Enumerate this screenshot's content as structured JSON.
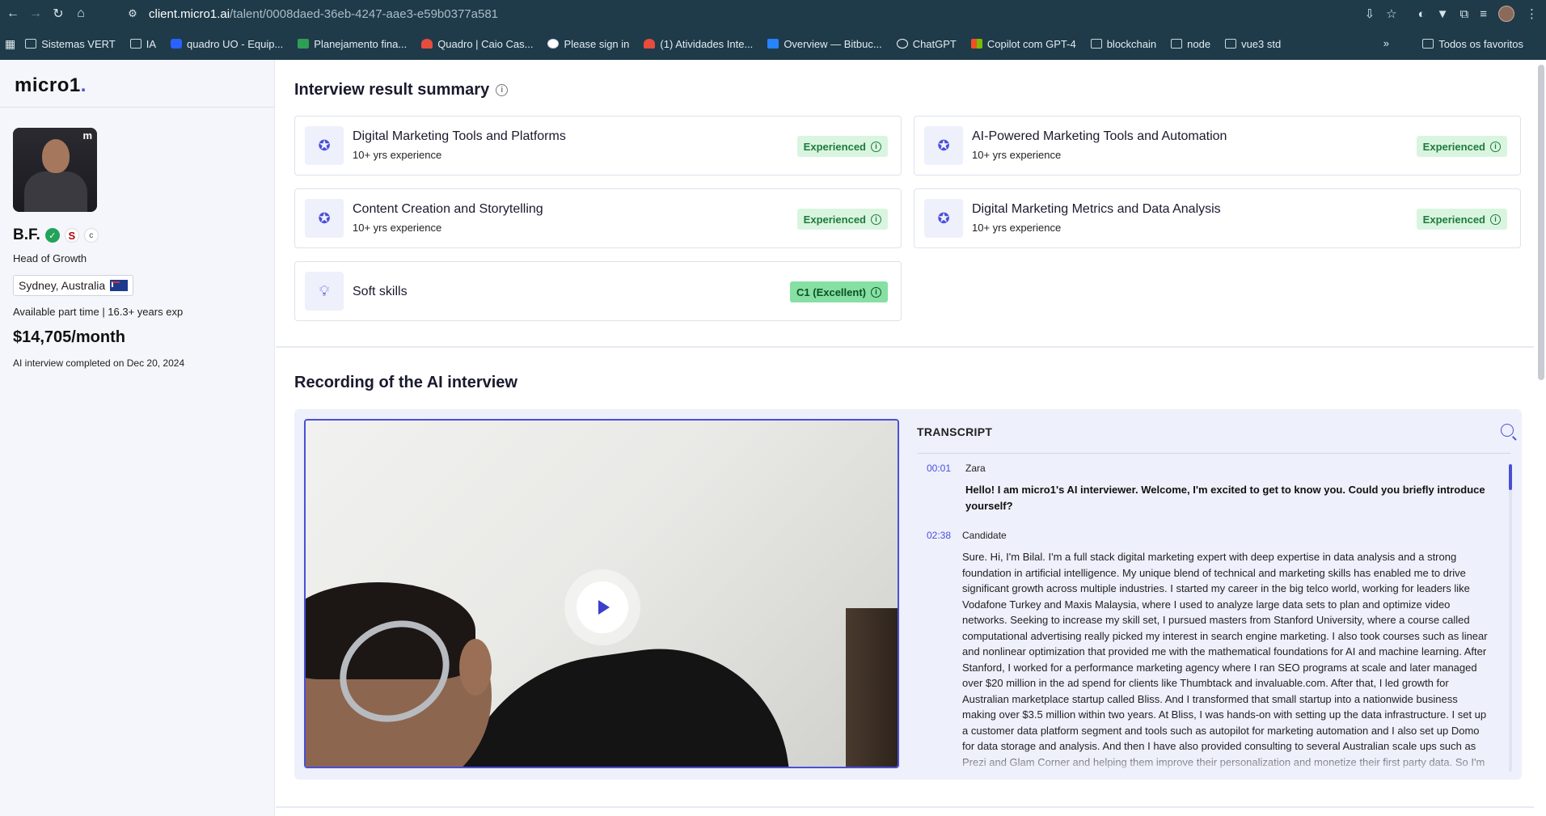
{
  "browser": {
    "url_host": "client.micro1.ai",
    "url_path": "/talent/0008daed-36eb-4247-aae3-e59b0377a581",
    "bookmarks": [
      {
        "label": "Sistemas VERT",
        "icon": "folder-icon"
      },
      {
        "label": "IA",
        "icon": "folder-icon"
      },
      {
        "label": "quadro UO - Equip...",
        "icon": "jira-icon"
      },
      {
        "label": "Planejamento fina...",
        "icon": "sheets-icon"
      },
      {
        "label": "Quadro | Caio Cas...",
        "icon": "monday-icon"
      },
      {
        "label": "Please sign in",
        "icon": "globe-icon"
      },
      {
        "label": "(1) Atividades Inte...",
        "icon": "monday-icon"
      },
      {
        "label": "Overview — Bitbuc...",
        "icon": "bitbucket-icon"
      },
      {
        "label": "ChatGPT",
        "icon": "openai-icon"
      },
      {
        "label": "Copilot com GPT-4",
        "icon": "microsoft-icon"
      },
      {
        "label": "blockchain",
        "icon": "folder-icon"
      },
      {
        "label": "node",
        "icon": "folder-icon"
      },
      {
        "label": "vue3 std",
        "icon": "folder-icon"
      }
    ],
    "more_label": "»",
    "all_bookmarks_label": "Todos os favoritos"
  },
  "sidebar": {
    "logo": "micro1",
    "logo_dot": ".",
    "photo_badge": "m",
    "name": "B.F.",
    "badge_c": "c",
    "stanford_badge": "S",
    "role": "Head of Growth",
    "location": "Sydney, Australia",
    "availability": "Available part time | 16.3+ years exp",
    "rate": "$14,705/month",
    "completed": "AI interview completed on Dec 20, 2024"
  },
  "summary": {
    "title": "Interview result summary",
    "skills": [
      {
        "name": "Digital Marketing Tools and Platforms",
        "experience": "10+ yrs experience",
        "level": "Experienced",
        "icon": "brain-star-icon"
      },
      {
        "name": "AI-Powered Marketing Tools and Automation",
        "experience": "10+ yrs experience",
        "level": "Experienced",
        "icon": "brain-star-icon"
      },
      {
        "name": "Content Creation and Storytelling",
        "experience": "10+ yrs experience",
        "level": "Experienced",
        "icon": "brain-star-icon"
      },
      {
        "name": "Digital Marketing Metrics and Data Analysis",
        "experience": "10+ yrs experience",
        "level": "Experienced",
        "icon": "brain-star-icon"
      },
      {
        "name": "Soft skills",
        "experience": "",
        "level": "C1 (Excellent)",
        "icon": "lightbulb-icon"
      }
    ]
  },
  "recording": {
    "title": "Recording of the AI interview",
    "transcript_title": "TRANSCRIPT",
    "entries": [
      {
        "time": "00:01",
        "speaker": "Zara",
        "text": "Hello! I am micro1's AI interviewer. Welcome, I'm excited to get to know you. Could you briefly introduce yourself?"
      },
      {
        "time": "02:38",
        "speaker": "Candidate",
        "text": "Sure. Hi, I'm Bilal. I'm a full stack digital marketing expert with deep expertise in data analysis and a strong foundation in artificial intelligence. My unique blend of technical and marketing skills has enabled me to drive significant growth across multiple industries. I started my career in the big telco world, working for leaders like Vodafone Turkey and Maxis Malaysia, where I used to analyze large data sets to plan and optimize video networks. Seeking to increase my skill set, I pursued masters from Stanford University, where a course called computational advertising really picked my interest in search engine marketing. I also took courses such as linear and nonlinear optimization that provided me with the mathematical foundations for AI and machine learning. After Stanford, I worked for a performance marketing agency where I ran SEO programs at scale and later managed over $20 million in the ad spend for clients like Thumbtack and invaluable.com. After that, I led growth for Australian marketplace startup called Bliss. And I transformed that small startup into a nationwide business making over $3.5 million within two years. At Bliss, I was hands-on with setting up the data infrastructure. I set up a customer data platform segment and tools such as autopilot for marketing automation and I also set up Domo for data storage and analysis. And then I have also provided consulting to several Australian scale ups such as Prezi and Glam Corner and helping them improve their personalization and monetize their first party data. So I'm keen to use my unique blend of"
      }
    ]
  },
  "colors": {
    "accent": "#4b4fd8",
    "experienced_bg": "#d9f5df",
    "excellent_bg": "#86e0a3",
    "chrome_bg": "#1f3b4a"
  }
}
